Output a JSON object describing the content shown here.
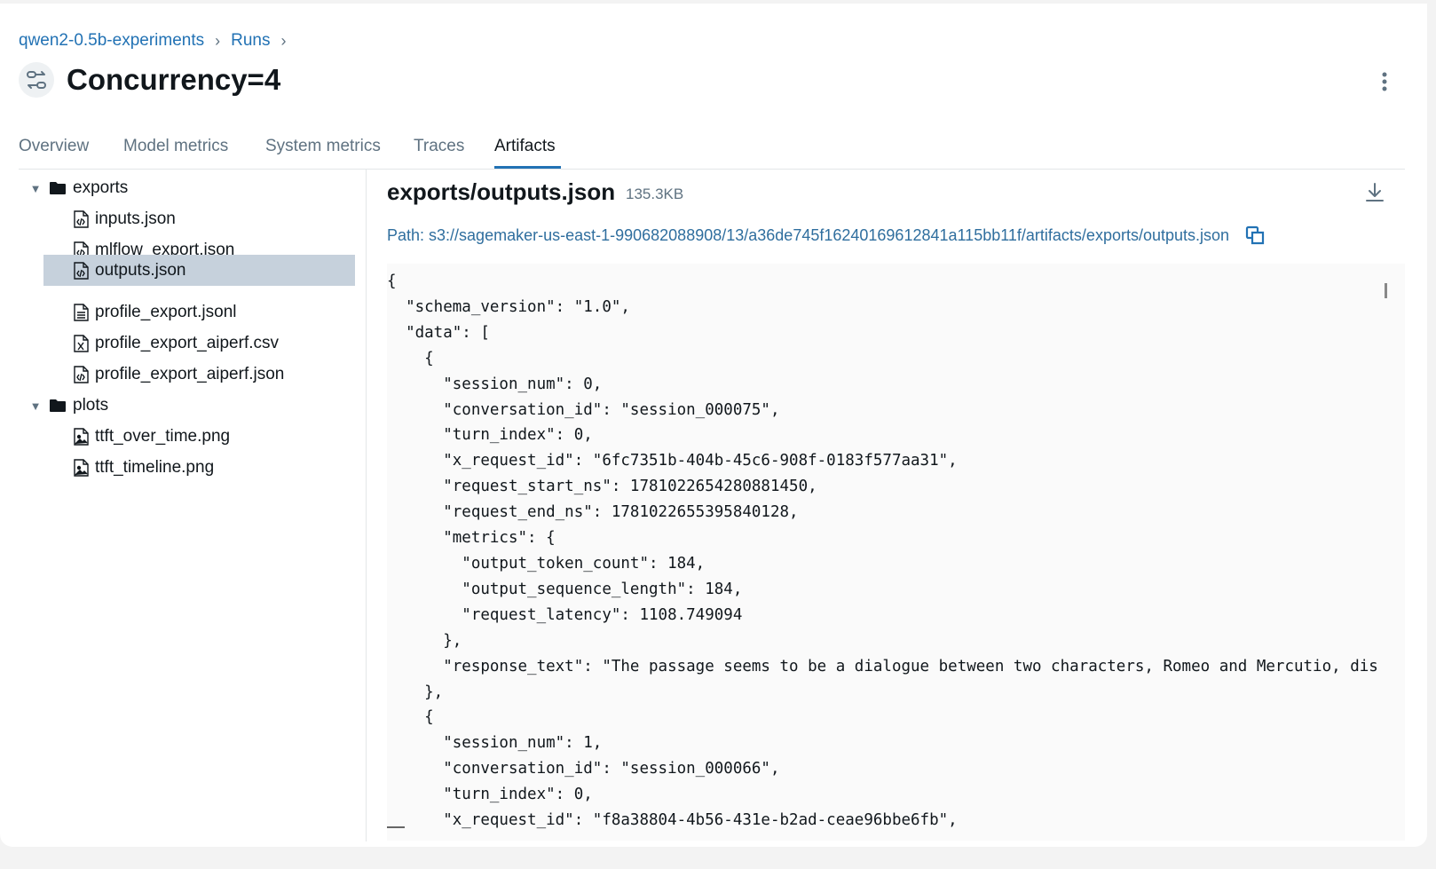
{
  "breadcrumb": {
    "experiment": "qwen2-0.5b-experiments",
    "sep1": "›",
    "runs": "Runs",
    "sep2": "›"
  },
  "run": {
    "title": "Concurrency=4",
    "icon": "run-icon"
  },
  "tabs": [
    {
      "label": "Overview",
      "active": false
    },
    {
      "label": "Model metrics",
      "active": false
    },
    {
      "label": "System metrics",
      "active": false
    },
    {
      "label": "Traces",
      "active": false
    },
    {
      "label": "Artifacts",
      "active": true
    }
  ],
  "tree": {
    "folders": [
      {
        "name": "exports",
        "expanded": true,
        "files": [
          {
            "name": "inputs.json",
            "icon": "file-code-icon"
          },
          {
            "name": "mlflow_export.json",
            "icon": "file-code-icon"
          },
          {
            "name": "outputs.json",
            "icon": "file-code-icon",
            "selected": true
          },
          {
            "name": "profile_export.jsonl",
            "icon": "file-text-icon"
          },
          {
            "name": "profile_export_aiperf.csv",
            "icon": "file-csv-icon"
          },
          {
            "name": "profile_export_aiperf.json",
            "icon": "file-code-icon"
          }
        ]
      },
      {
        "name": "plots",
        "expanded": true,
        "files": [
          {
            "name": "ttft_over_time.png",
            "icon": "file-image-icon"
          },
          {
            "name": "ttft_timeline.png",
            "icon": "file-image-icon"
          }
        ]
      }
    ]
  },
  "viewer": {
    "file_title": "exports/outputs.json",
    "file_size": "135.3KB",
    "path": "Path: s3://sagemaker-us-east-1-990682088908/13/a36de745f16240169612841a115bb11f/artifacts/exports/outputs.json",
    "content": "{\n  \"schema_version\": \"1.0\",\n  \"data\": [\n    {\n      \"session_num\": 0,\n      \"conversation_id\": \"session_000075\",\n      \"turn_index\": 0,\n      \"x_request_id\": \"6fc7351b-404b-45c6-908f-0183f577aa31\",\n      \"request_start_ns\": 1781022654280881450,\n      \"request_end_ns\": 1781022655395840128,\n      \"metrics\": {\n        \"output_token_count\": 184,\n        \"output_sequence_length\": 184,\n        \"request_latency\": 1108.749094\n      },\n      \"response_text\": \"The passage seems to be a dialogue between two characters, Romeo and Mercutio, dis\n    },\n    {\n      \"session_num\": 1,\n      \"conversation_id\": \"session_000066\",\n      \"turn_index\": 0,\n      \"x_request_id\": \"f8a38804-4b56-431e-b2ad-ceae96bbe6fb\","
  },
  "colors": {
    "link": "#2272b4",
    "selected_row": "#c6d1dc",
    "code_bg": "#fafafa"
  }
}
